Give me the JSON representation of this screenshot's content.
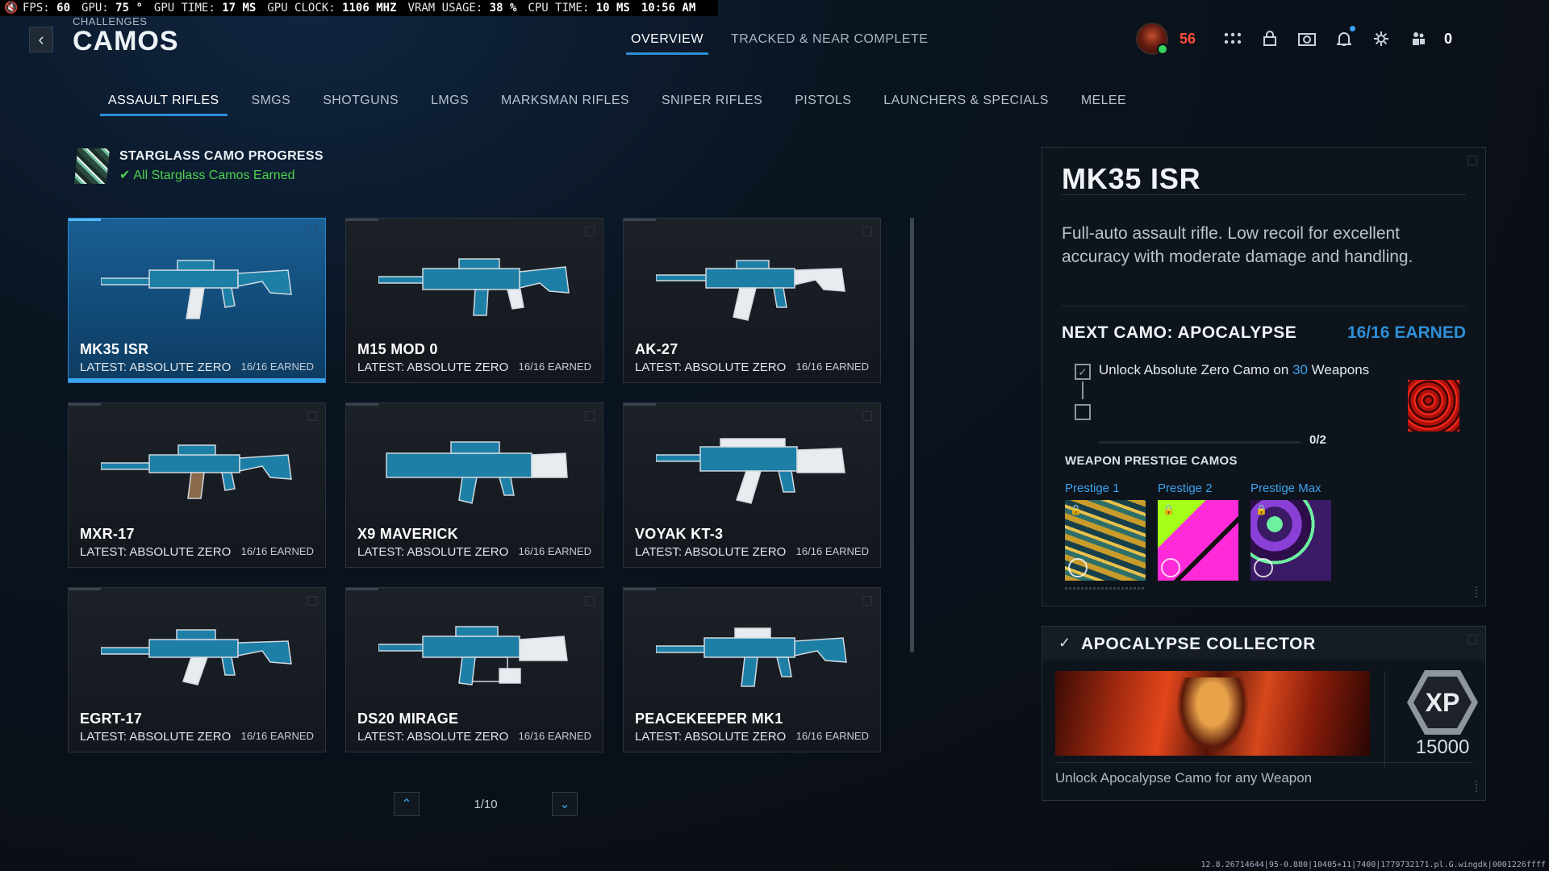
{
  "perf": {
    "fps_label": "FPS:",
    "fps": "60",
    "gpu_label": "GPU:",
    "gpu": "75 °",
    "gpu_time_label": "GPU TIME:",
    "gpu_time": "17 MS",
    "gpu_clock_label": "GPU CLOCK:",
    "gpu_clock": "1106 MHZ",
    "vram_label": "VRAM USAGE:",
    "vram": "38 %",
    "cpu_time_label": "CPU TIME:",
    "cpu_time": "10 MS",
    "clock": "10:56 AM"
  },
  "header": {
    "breadcrumb": "CHALLENGES",
    "title": "CAMOS",
    "tabs": [
      {
        "label": "OVERVIEW",
        "active": true
      },
      {
        "label": "TRACKED & NEAR COMPLETE",
        "active": false
      }
    ],
    "level": "56",
    "friends_online": "0"
  },
  "categories": [
    {
      "label": "ASSAULT RIFLES",
      "active": true
    },
    {
      "label": "SMGS"
    },
    {
      "label": "SHOTGUNS"
    },
    {
      "label": "LMGS"
    },
    {
      "label": "MARKSMAN RIFLES"
    },
    {
      "label": "SNIPER RIFLES"
    },
    {
      "label": "PISTOLS"
    },
    {
      "label": "LAUNCHERS & SPECIALS"
    },
    {
      "label": "MELEE"
    }
  ],
  "starglass": {
    "title": "STARGLASS CAMO PROGRESS",
    "status": "All Starglass Camos Earned"
  },
  "weapons": [
    {
      "name": "MK35 ISR",
      "latest": "LATEST: ABSOLUTE ZERO",
      "earned": "16/16 EARNED"
    },
    {
      "name": "M15 MOD 0",
      "latest": "LATEST: ABSOLUTE ZERO",
      "earned": "16/16 EARNED"
    },
    {
      "name": "AK-27",
      "latest": "LATEST: ABSOLUTE ZERO",
      "earned": "16/16 EARNED"
    },
    {
      "name": "MXR-17",
      "latest": "LATEST: ABSOLUTE ZERO",
      "earned": "16/16 EARNED"
    },
    {
      "name": "X9 MAVERICK",
      "latest": "LATEST: ABSOLUTE ZERO",
      "earned": "16/16 EARNED"
    },
    {
      "name": "VOYAK KT-3",
      "latest": "LATEST: ABSOLUTE ZERO",
      "earned": "16/16 EARNED"
    },
    {
      "name": "EGRT-17",
      "latest": "LATEST: ABSOLUTE ZERO",
      "earned": "16/16 EARNED"
    },
    {
      "name": "DS20 MIRAGE",
      "latest": "LATEST: ABSOLUTE ZERO",
      "earned": "16/16 EARNED"
    },
    {
      "name": "PEACEKEEPER MK1",
      "latest": "LATEST: ABSOLUTE ZERO",
      "earned": "16/16 EARNED"
    }
  ],
  "pager": {
    "text": "1/10"
  },
  "detail": {
    "title": "MK35 ISR",
    "description": "Full-auto assault rifle. Low recoil for excellent accuracy with moderate damage and handling.",
    "next_camo": "NEXT CAMO: APOCALYPSE",
    "next_earned": "16/16 EARNED",
    "task_prefix": "Unlock Absolute Zero Camo on ",
    "task_count": "30",
    "task_suffix": " Weapons",
    "progress_text": "0/2",
    "progress_fraction": 0,
    "prestige_header": "WEAPON PRESTIGE CAMOS",
    "prestige": [
      {
        "label": "Prestige 1"
      },
      {
        "label": "Prestige 2"
      },
      {
        "label": "Prestige Max"
      }
    ]
  },
  "collector": {
    "title": "APOCALYPSE COLLECTOR",
    "xp_badge": "XP",
    "xp_value": "15000",
    "description": "Unlock Apocalypse Camo for any Weapon"
  },
  "version": "12.8.26714644|95-0.880|10405+11|7400|1779732171.pl.G.wingdk|0001226ffff",
  "colors": {
    "accent": "#2e8fd6",
    "success": "#4fd24f",
    "level": "#ff4d3a"
  }
}
